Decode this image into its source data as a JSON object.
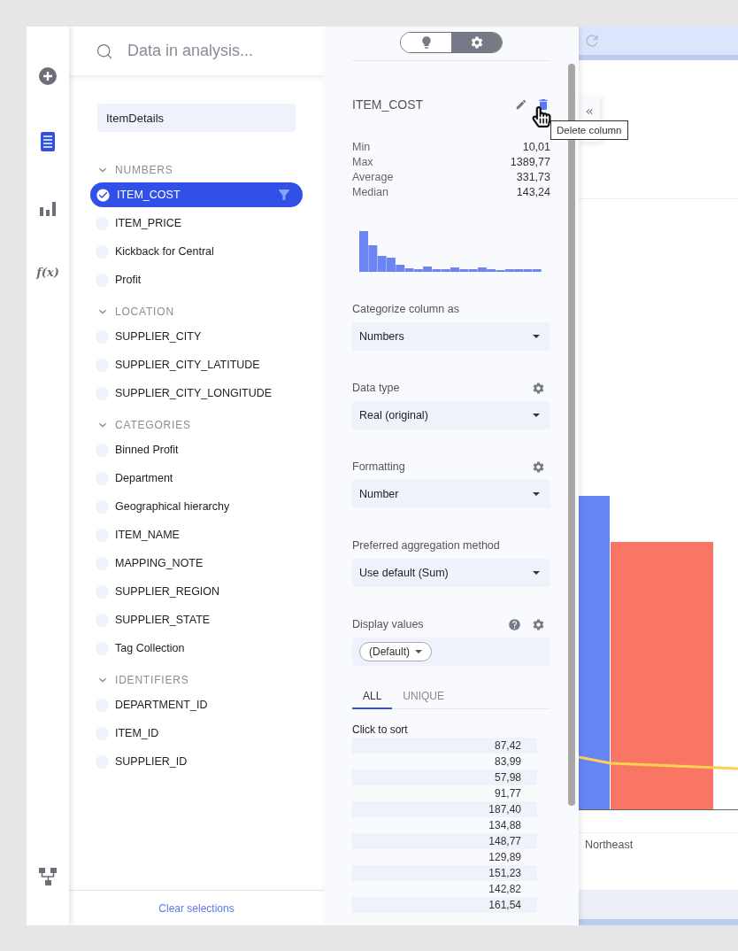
{
  "rail": {
    "items": [
      {
        "kind": "add",
        "selected": false
      },
      {
        "kind": "data",
        "selected": true
      },
      {
        "kind": "charts",
        "selected": false
      },
      {
        "kind": "function",
        "label": "f(x)",
        "selected": false
      },
      {
        "kind": "hierarchy",
        "selected": false
      }
    ]
  },
  "data_panel": {
    "search": {
      "placeholder": "Data in analysis..."
    },
    "table": "ItemDetails",
    "groups": [
      {
        "name": "NUMBERS",
        "expanded": true,
        "columns": [
          {
            "label": "ITEM_COST",
            "selected": true
          },
          {
            "label": "ITEM_PRICE",
            "selected": false
          },
          {
            "label": "Kickback for Central",
            "selected": false
          },
          {
            "label": "Profit",
            "selected": false
          }
        ]
      },
      {
        "name": "LOCATION",
        "expanded": true,
        "columns": [
          {
            "label": "SUPPLIER_CITY",
            "selected": false
          },
          {
            "label": "SUPPLIER_CITY_LATITUDE",
            "selected": false
          },
          {
            "label": "SUPPLIER_CITY_LONGITUDE",
            "selected": false
          }
        ]
      },
      {
        "name": "CATEGORIES",
        "expanded": true,
        "columns": [
          {
            "label": "Binned Profit",
            "selected": false
          },
          {
            "label": "Department",
            "selected": false
          },
          {
            "label": "Geographical hierarchy",
            "selected": false
          },
          {
            "label": "ITEM_NAME",
            "selected": false
          },
          {
            "label": "MAPPING_NOTE",
            "selected": false
          },
          {
            "label": "SUPPLIER_REGION",
            "selected": false
          },
          {
            "label": "SUPPLIER_STATE",
            "selected": false
          },
          {
            "label": "Tag Collection",
            "selected": false
          }
        ]
      },
      {
        "name": "IDENTIFIERS",
        "expanded": true,
        "columns": [
          {
            "label": "DEPARTMENT_ID",
            "selected": false
          },
          {
            "label": "ITEM_ID",
            "selected": false
          },
          {
            "label": "SUPPLIER_ID",
            "selected": false
          }
        ]
      }
    ],
    "footer_link": "Clear selections"
  },
  "details_panel": {
    "mode_toggle": [
      {
        "kind": "insights",
        "selected": false
      },
      {
        "kind": "settings",
        "selected": true
      }
    ],
    "column_name": "ITEM_COST",
    "tooltip": "Delete column",
    "stats": [
      {
        "label": "Min",
        "value": "10,01"
      },
      {
        "label": "Max",
        "value": "1389,77"
      },
      {
        "label": "Average",
        "value": "331,73"
      },
      {
        "label": "Median",
        "value": "143,24"
      }
    ],
    "fields": [
      {
        "label": "Categorize column as",
        "kind": "select",
        "value": "Numbers",
        "help_button": false,
        "settings_button": false
      },
      {
        "label": "Data type",
        "kind": "select",
        "value": "Real (original)",
        "help_button": false,
        "settings_button": true
      },
      {
        "label": "Formatting",
        "kind": "select",
        "value": "Number",
        "help_button": false,
        "settings_button": true
      },
      {
        "label": "Preferred aggregation method",
        "kind": "select",
        "value": "Use default (Sum)",
        "help_button": false,
        "settings_button": false
      },
      {
        "label": "Display values",
        "kind": "chips",
        "value": "(Default)",
        "help_button": true,
        "settings_button": true
      }
    ],
    "value_tabs": [
      {
        "label": "ALL",
        "selected": true
      },
      {
        "label": "UNIQUE",
        "selected": false
      }
    ],
    "sort_hint": "Click to sort",
    "values": [
      "87,42",
      "83,99",
      "57,98",
      "91,77",
      "187,40",
      "134,88",
      "148,77",
      "129,89",
      "151,23",
      "142,82",
      "161,54"
    ]
  },
  "visualization": {
    "category": "Northeast"
  }
}
